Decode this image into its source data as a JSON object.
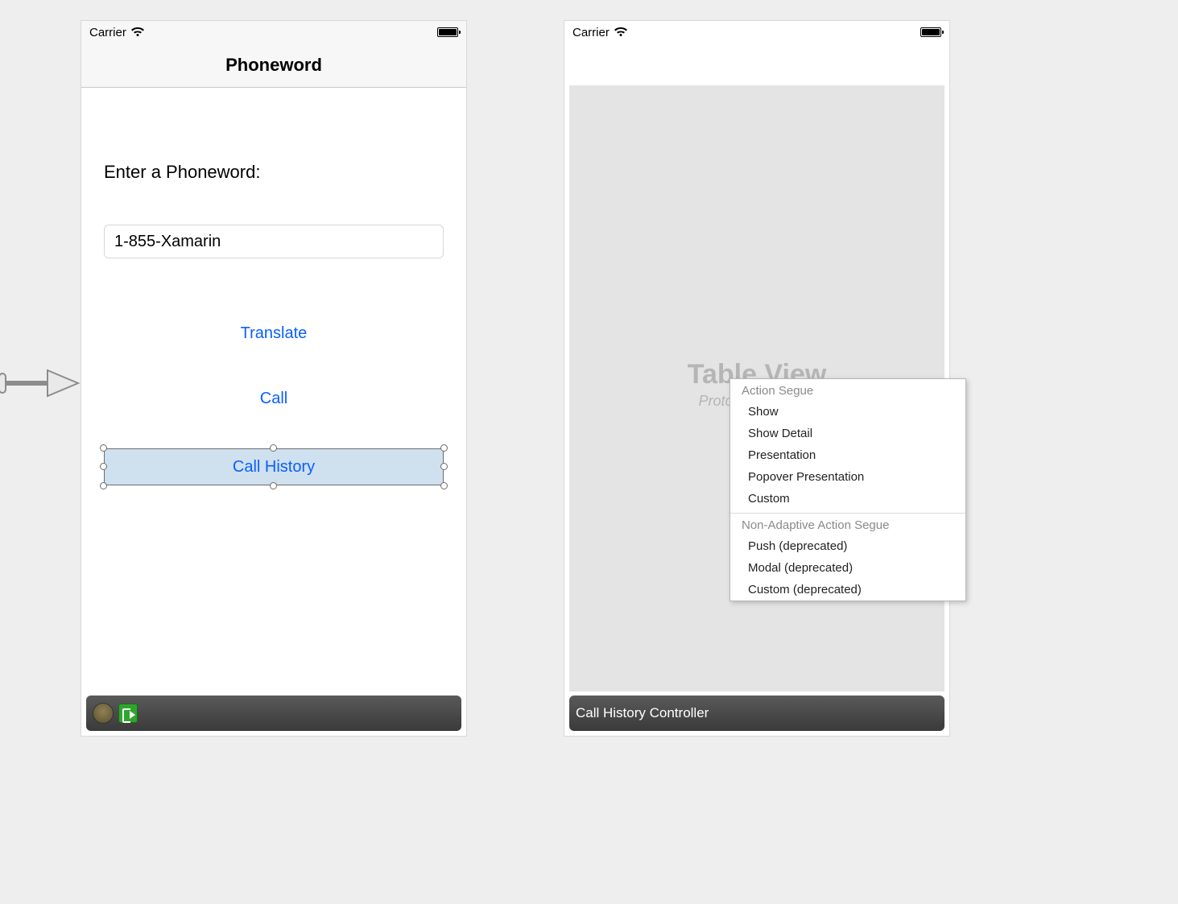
{
  "left": {
    "status_carrier": "Carrier",
    "nav_title": "Phoneword",
    "prompt": "Enter a Phoneword:",
    "phoneword_value": "1-855-Xamarin",
    "translate_label": "Translate",
    "call_label": "Call",
    "call_history_label": "Call History"
  },
  "right": {
    "status_carrier": "Carrier",
    "tableview_title": "Table View",
    "tableview_subtitle": "Prototype Content",
    "controller_label": "Call History Controller"
  },
  "segue_menu": {
    "section1_title": "Action Segue",
    "items1": [
      "Show",
      "Show Detail",
      "Presentation",
      "Popover Presentation",
      "Custom"
    ],
    "section2_title": "Non-Adaptive Action Segue",
    "items2": [
      "Push (deprecated)",
      "Modal (deprecated)",
      "Custom (deprecated)"
    ],
    "highlighted": "Show"
  }
}
